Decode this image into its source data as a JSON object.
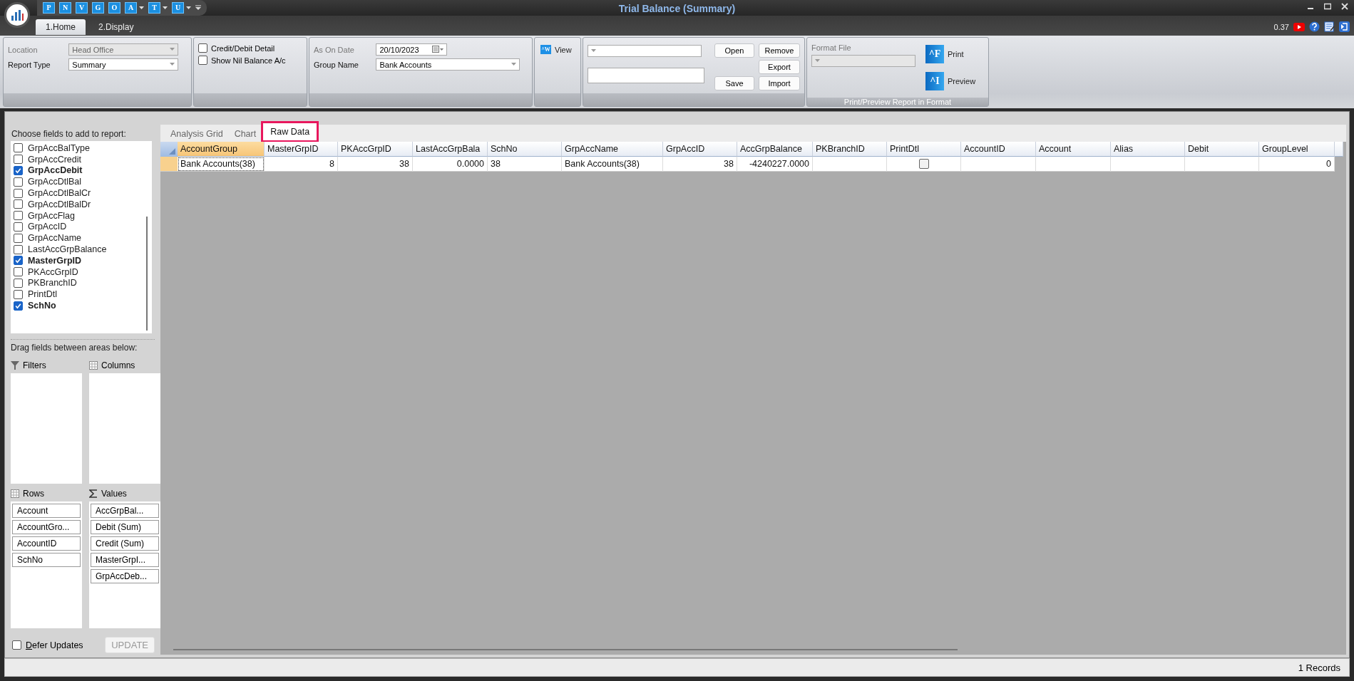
{
  "window": {
    "title": "Trial Balance (Summary)",
    "version": "0.37"
  },
  "quick_access": [
    {
      "label": "P",
      "dropdown": false
    },
    {
      "label": "N",
      "dropdown": false
    },
    {
      "label": "V",
      "dropdown": false
    },
    {
      "label": "G",
      "dropdown": false
    },
    {
      "label": "O",
      "dropdown": false
    },
    {
      "label": "A",
      "dropdown": true
    },
    {
      "label": "T",
      "dropdown": true
    },
    {
      "label": "U",
      "dropdown": true
    }
  ],
  "ribbon_tabs": [
    {
      "label": "1.Home",
      "selected": true
    },
    {
      "label": "2.Display",
      "selected": false
    }
  ],
  "ribbon": {
    "location": {
      "label": "Location",
      "value": "Head Office",
      "disabled": true
    },
    "report_type": {
      "label": "Report Type",
      "value": "Summary",
      "disabled": false
    },
    "options": [
      {
        "label": "Credit/Debit Detail",
        "checked": false
      },
      {
        "label": "Show Nil Balance A/c",
        "checked": false
      }
    ],
    "as_on_date": {
      "label": "As On Date",
      "value": "20/10/2023"
    },
    "group_name": {
      "label": "Group Name",
      "value": "Bank Accounts"
    },
    "view_button": {
      "letter": "^W",
      "label": "View"
    },
    "layout_buttons": [
      "Open",
      "Remove",
      "Export",
      "Save",
      "Import"
    ],
    "format": {
      "label": "Format File",
      "buttons": [
        {
          "letter": "^F",
          "label": "Print"
        },
        {
          "letter": "^I",
          "label": "Preview"
        }
      ],
      "caption": "Print/Preview Report in Format"
    }
  },
  "field_list": {
    "title": "Choose fields to add to report:",
    "fields": [
      {
        "label": "GrpAccBalType",
        "checked": false
      },
      {
        "label": "GrpAccCredit",
        "checked": false
      },
      {
        "label": "GrpAccDebit",
        "checked": true
      },
      {
        "label": "GrpAccDtlBal",
        "checked": false
      },
      {
        "label": "GrpAccDtlBalCr",
        "checked": false
      },
      {
        "label": "GrpAccDtlBalDr",
        "checked": false
      },
      {
        "label": "GrpAccFlag",
        "checked": false
      },
      {
        "label": "GrpAccID",
        "checked": false
      },
      {
        "label": "GrpAccName",
        "checked": false
      },
      {
        "label": "LastAccGrpBalance",
        "checked": false
      },
      {
        "label": "MasterGrpID",
        "checked": true
      },
      {
        "label": "PKAccGrpID",
        "checked": false
      },
      {
        "label": "PKBranchID",
        "checked": false
      },
      {
        "label": "PrintDtl",
        "checked": false
      },
      {
        "label": "SchNo",
        "checked": true
      }
    ]
  },
  "drag_hint": "Drag fields between areas below:",
  "areas": [
    {
      "kind": "filters",
      "label": "Filters"
    },
    {
      "kind": "columns",
      "label": "Columns"
    },
    {
      "kind": "rows",
      "label": "Rows",
      "items": [
        "Account",
        "AccountGro...",
        "AccountID",
        "SchNo"
      ]
    },
    {
      "kind": "values",
      "label": "Values",
      "items": [
        "AccGrpBal...",
        "Debit (Sum)",
        "Credit (Sum)",
        "MasterGrpI...",
        "GrpAccDeb..."
      ]
    }
  ],
  "defer_updates": {
    "label": "Defer Updates",
    "checked": false
  },
  "update_button": "UPDATE",
  "view_tabs": [
    {
      "label": "Analysis Grid",
      "selected": false,
      "highlighted": false
    },
    {
      "label": "Chart",
      "selected": false,
      "highlighted": false
    },
    {
      "label": "Raw Data",
      "selected": true,
      "highlighted": true
    }
  ],
  "table": {
    "columns": [
      {
        "label": "AccountGroup",
        "selected": true
      },
      {
        "label": "MasterGrpID",
        "selected": false
      },
      {
        "label": "PKAccGrpID",
        "selected": false
      },
      {
        "label": "LastAccGrpBala",
        "selected": false
      },
      {
        "label": "SchNo",
        "selected": false
      },
      {
        "label": "GrpAccName",
        "selected": false
      },
      {
        "label": "GrpAccID",
        "selected": false
      },
      {
        "label": "AccGrpBalance",
        "selected": false
      },
      {
        "label": "PKBranchID",
        "selected": false
      },
      {
        "label": "PrintDtl",
        "selected": false
      },
      {
        "label": "AccountID",
        "selected": false
      },
      {
        "label": "Account",
        "selected": false
      },
      {
        "label": "Alias",
        "selected": false
      },
      {
        "label": "Debit",
        "selected": false
      },
      {
        "label": "GroupLevel",
        "selected": false
      }
    ],
    "rows": [
      {
        "selected": true,
        "cells": [
          {
            "kind": "text",
            "text": "Bank Accounts(38)"
          },
          {
            "kind": "number",
            "text": "8"
          },
          {
            "kind": "number",
            "text": "38"
          },
          {
            "kind": "number",
            "text": "0.0000"
          },
          {
            "kind": "text",
            "text": "38"
          },
          {
            "kind": "text",
            "text": "Bank Accounts(38)"
          },
          {
            "kind": "number",
            "text": "38"
          },
          {
            "kind": "number",
            "text": "-4240227.0000"
          },
          {
            "kind": "blank"
          },
          {
            "kind": "checkbox",
            "checked": false
          },
          {
            "kind": "blank"
          },
          {
            "kind": "blank"
          },
          {
            "kind": "blank"
          },
          {
            "kind": "blank"
          },
          {
            "kind": "number",
            "text": "0"
          }
        ]
      }
    ]
  },
  "status_bar": {
    "records": "1 Records"
  }
}
